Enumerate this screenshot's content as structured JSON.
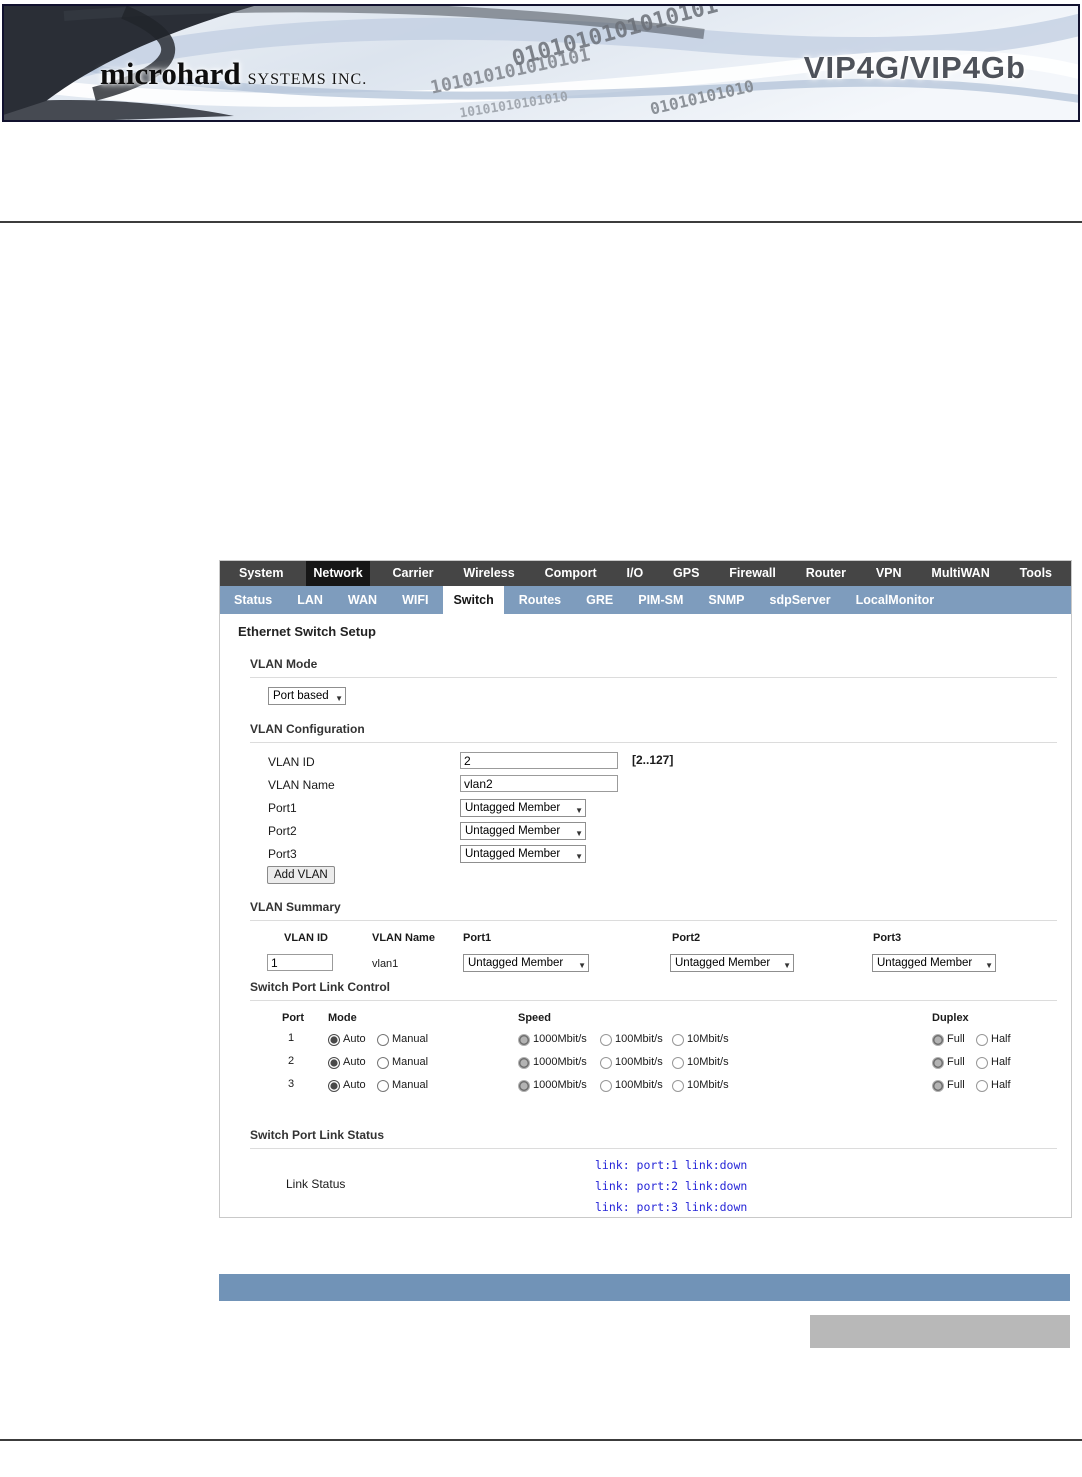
{
  "banner": {
    "logo_main": "microhard",
    "logo_sub": "SYSTEMS INC.",
    "product": "VIP4G/VIP4Gb",
    "binary_decoration": [
      "101010101010101",
      "0101010101010101",
      "10101010101010",
      "01010101010"
    ]
  },
  "nav_primary": {
    "items": [
      {
        "label": "System",
        "active": false
      },
      {
        "label": "Network",
        "active": true
      },
      {
        "label": "Carrier",
        "active": false
      },
      {
        "label": "Wireless",
        "active": false
      },
      {
        "label": "Comport",
        "active": false
      },
      {
        "label": "I/O",
        "active": false
      },
      {
        "label": "GPS",
        "active": false
      },
      {
        "label": "Firewall",
        "active": false
      },
      {
        "label": "Router",
        "active": false
      },
      {
        "label": "VPN",
        "active": false
      },
      {
        "label": "MultiWAN",
        "active": false
      },
      {
        "label": "Tools",
        "active": false
      }
    ]
  },
  "nav_secondary": {
    "items": [
      {
        "label": "Status",
        "active": false
      },
      {
        "label": "LAN",
        "active": false
      },
      {
        "label": "WAN",
        "active": false
      },
      {
        "label": "WIFI",
        "active": false
      },
      {
        "label": "Switch",
        "active": true
      },
      {
        "label": "Routes",
        "active": false
      },
      {
        "label": "GRE",
        "active": false
      },
      {
        "label": "PIM-SM",
        "active": false
      },
      {
        "label": "SNMP",
        "active": false
      },
      {
        "label": "sdpServer",
        "active": false
      },
      {
        "label": "LocalMonitor",
        "active": false
      }
    ]
  },
  "page": {
    "title": "Ethernet Switch Setup",
    "vlan_mode": {
      "heading": "VLAN Mode",
      "value": "Port based"
    },
    "vlan_config": {
      "heading": "VLAN Configuration",
      "vlan_id_label": "VLAN ID",
      "vlan_id_value": "2",
      "vlan_id_hint": "[2..127]",
      "vlan_name_label": "VLAN Name",
      "vlan_name_value": "vlan2",
      "ports": [
        {
          "label": "Port1",
          "value": "Untagged Member"
        },
        {
          "label": "Port2",
          "value": "Untagged Member"
        },
        {
          "label": "Port3",
          "value": "Untagged Member"
        }
      ],
      "add_button": "Add VLAN"
    },
    "vlan_summary": {
      "heading": "VLAN Summary",
      "headers": [
        "VLAN ID",
        "VLAN Name",
        "Port1",
        "Port2",
        "Port3"
      ],
      "rows": [
        {
          "vlan_id": "1",
          "vlan_name": "vlan1",
          "port1": "Untagged Member",
          "port2": "Untagged Member",
          "port3": "Untagged Member"
        }
      ]
    },
    "link_control": {
      "heading": "Switch Port Link Control",
      "headers": [
        "Port",
        "Mode",
        "Speed",
        "Duplex"
      ],
      "mode_options": [
        "Auto",
        "Manual"
      ],
      "speed_options": [
        "1000Mbit/s",
        "100Mbit/s",
        "10Mbit/s"
      ],
      "duplex_options": [
        "Full",
        "Half"
      ],
      "rows": [
        {
          "port": "1",
          "mode": "Auto",
          "speed": "1000Mbit/s",
          "duplex": "Full"
        },
        {
          "port": "2",
          "mode": "Auto",
          "speed": "1000Mbit/s",
          "duplex": "Full"
        },
        {
          "port": "3",
          "mode": "Auto",
          "speed": "1000Mbit/s",
          "duplex": "Full"
        }
      ]
    },
    "link_status": {
      "heading": "Switch Port Link Status",
      "label": "Link Status",
      "lines": [
        "link: port:1 link:down",
        "link: port:2 link:down",
        "link: port:3 link:down"
      ]
    }
  }
}
